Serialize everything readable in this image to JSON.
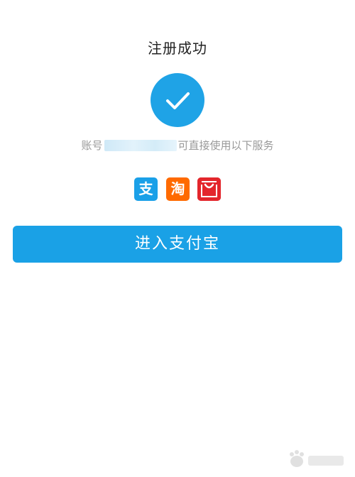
{
  "page": {
    "title": "注册成功"
  },
  "status": {
    "icon": "checkmark-icon",
    "accent_color": "#1fa3e6"
  },
  "account": {
    "prefix": "账号",
    "suffix": "可直接使用以下服务"
  },
  "services": [
    {
      "name": "alipay",
      "icon_text": "支",
      "color": "#1aa0e8"
    },
    {
      "name": "taobao",
      "icon_text": "淘",
      "color": "#ff6a00"
    },
    {
      "name": "tmall",
      "icon_text": "",
      "color": "#e3262c"
    }
  ],
  "actions": {
    "enter_label": "进入支付宝",
    "button_color": "#1aa1e6"
  }
}
